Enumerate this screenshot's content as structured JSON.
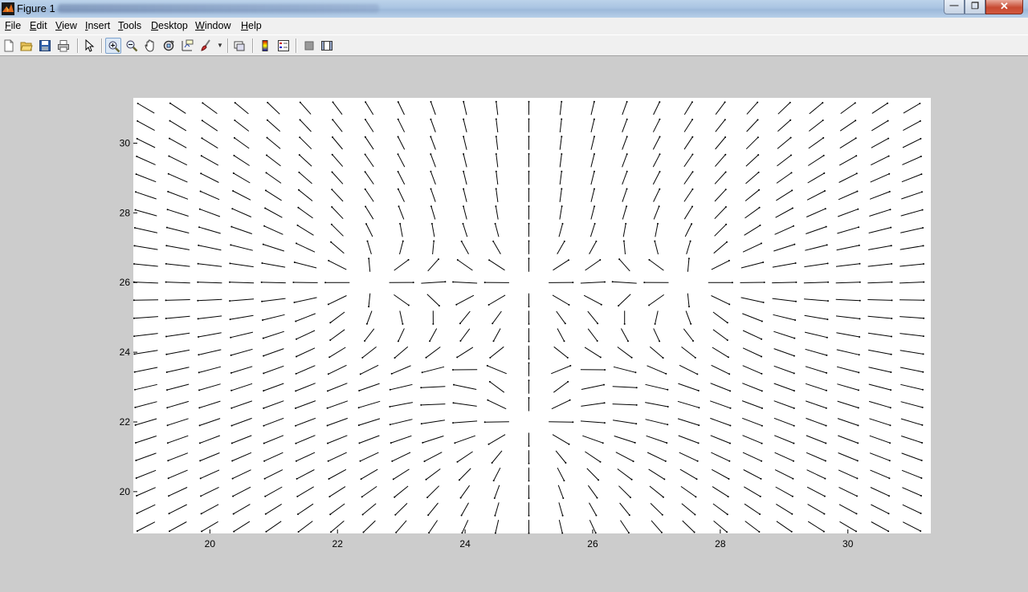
{
  "window": {
    "title": "Figure 1",
    "buttons": [
      "minimize",
      "maximize",
      "close"
    ]
  },
  "menu": [
    {
      "label": "File",
      "accel": "F",
      "rest": "ile"
    },
    {
      "label": "Edit",
      "accel": "E",
      "rest": "dit"
    },
    {
      "label": "View",
      "accel": "V",
      "rest": "iew"
    },
    {
      "label": "Insert",
      "accel": "I",
      "rest": "nsert"
    },
    {
      "label": "Tools",
      "accel": "T",
      "rest": "ools"
    },
    {
      "label": "Desktop",
      "accel": "D",
      "rest": "esktop"
    },
    {
      "label": "Window",
      "accel": "W",
      "rest": "indow"
    },
    {
      "label": "Help",
      "accel": "H",
      "rest": "elp"
    }
  ],
  "toolbar": {
    "buttons": [
      {
        "name": "new-figure-icon"
      },
      {
        "name": "open-file-icon"
      },
      {
        "name": "save-icon"
      },
      {
        "name": "print-icon"
      },
      {
        "name": "edit-plot-icon"
      },
      {
        "name": "zoom-in-icon",
        "active": true
      },
      {
        "name": "zoom-out-icon"
      },
      {
        "name": "pan-icon"
      },
      {
        "name": "rotate-3d-icon"
      },
      {
        "name": "data-cursor-icon"
      },
      {
        "name": "brush-icon"
      },
      {
        "name": "link-plot-icon"
      },
      {
        "name": "colorbar-icon"
      },
      {
        "name": "legend-icon"
      },
      {
        "name": "hide-plot-tools-icon"
      },
      {
        "name": "show-plot-tools-icon"
      }
    ]
  },
  "chart_data": {
    "type": "quiver",
    "title": "",
    "xlabel": "",
    "ylabel": "",
    "xlim": [
      18.8,
      31.3
    ],
    "ylim": [
      18.8,
      31.3
    ],
    "xticks": [
      20,
      22,
      24,
      26,
      28,
      30
    ],
    "yticks": [
      20,
      22,
      24,
      26,
      28,
      30
    ],
    "grid": false,
    "arrow_color": "#000000",
    "background": "#ffffff",
    "grid_spacing": 0.5,
    "field": {
      "description_of_sources": "radial field emanating from point charges",
      "sources": [
        {
          "x": 22.5,
          "y": 26
        },
        {
          "x": 27.5,
          "y": 26
        },
        {
          "x": 25,
          "y": 22
        },
        {
          "x": 25,
          "y": 26
        }
      ]
    }
  }
}
